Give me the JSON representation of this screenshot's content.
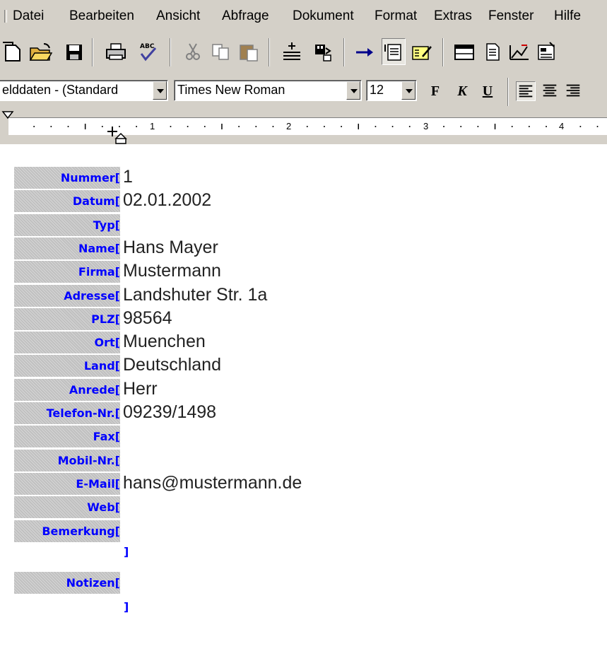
{
  "menu": {
    "items": [
      "Datei",
      "Bearbeiten",
      "Ansicht",
      "Abfrage",
      "Dokument",
      "Format",
      "Extras",
      "Fenster",
      "Hilfe"
    ]
  },
  "toolbar": {
    "buttons": [
      "new-doc-icon",
      "open-folder-icon",
      "save-icon",
      "print-icon",
      "spellcheck-icon",
      "cut-icon",
      "copy-icon",
      "paste-icon",
      "insert-field-icon",
      "database-icon",
      "arrow-right-icon",
      "document-active-icon",
      "form-edit-icon",
      "window-icon",
      "page-icon",
      "chart-edit-icon",
      "form-icon"
    ]
  },
  "format": {
    "style": "elddaten - (Standard",
    "font": "Times New Roman",
    "size": "12",
    "bold": "F",
    "italic": "K",
    "underline": "U"
  },
  "ruler": {
    "numbers": [
      "1",
      "2",
      "3",
      "4"
    ]
  },
  "fields": [
    {
      "label": "Nummer[",
      "value": "1"
    },
    {
      "label": "Datum[",
      "value": "02.01.2002"
    },
    {
      "label": "Typ[",
      "value": ""
    },
    {
      "label": "Name[",
      "value": "Hans Mayer"
    },
    {
      "label": "Firma[",
      "value": "Mustermann"
    },
    {
      "label": "Adresse[",
      "value": "Landshuter Str. 1a"
    },
    {
      "label": "PLZ[",
      "value": "98564"
    },
    {
      "label": "Ort[",
      "value": "Muenchen"
    },
    {
      "label": "Land[",
      "value": "Deutschland"
    },
    {
      "label": "Anrede[",
      "value": "Herr"
    },
    {
      "label": "Telefon-Nr.[",
      "value": "09239/1498"
    },
    {
      "label": "Fax[",
      "value": ""
    },
    {
      "label": "Mobil-Nr.[",
      "value": ""
    },
    {
      "label": "E-Mail[",
      "value": "hans@mustermann.de"
    },
    {
      "label": "Web[",
      "value": ""
    },
    {
      "label": "Bemerkung[",
      "value": ""
    }
  ],
  "closing_bracket": "]",
  "notes": {
    "label": "Notizen[",
    "close": "]"
  },
  "colors": {
    "field_label": "#0000ff",
    "chrome": "#d4d0c8"
  }
}
